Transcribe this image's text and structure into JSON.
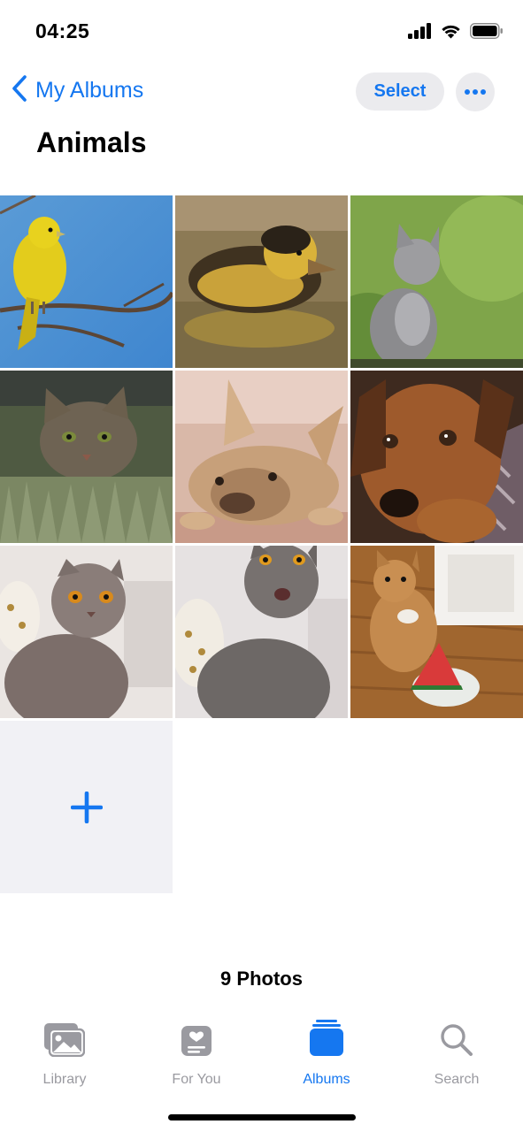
{
  "status_bar": {
    "time": "04:25",
    "icons": [
      "cellular-signal-icon",
      "wifi-icon",
      "battery-icon"
    ]
  },
  "nav": {
    "back_label": "My Albums",
    "select_label": "Select",
    "more_icon": "ellipsis-icon"
  },
  "album": {
    "title": "Animals",
    "photos": [
      {
        "subject": "yellow-bird"
      },
      {
        "subject": "duckling"
      },
      {
        "subject": "grey-kitten"
      },
      {
        "subject": "tabby-cat-in-grass"
      },
      {
        "subject": "french-bulldog"
      },
      {
        "subject": "brown-puppy"
      },
      {
        "subject": "scottish-fold-cat"
      },
      {
        "subject": "grey-british-cat"
      },
      {
        "subject": "orange-cat-with-watermelon"
      }
    ],
    "add_icon": "plus-icon",
    "count_label": "9 Photos"
  },
  "tabbar": {
    "tabs": [
      {
        "label": "Library",
        "icon": "photo-library-icon"
      },
      {
        "label": "For You",
        "icon": "for-you-icon"
      },
      {
        "label": "Albums",
        "icon": "albums-icon"
      },
      {
        "label": "Search",
        "icon": "search-icon"
      }
    ],
    "active": "Albums"
  },
  "colors": {
    "accent": "#1577f0",
    "inactive": "#9a9aa0",
    "button_bg": "#ebebee",
    "add_tile_bg": "#f1f1f5"
  }
}
